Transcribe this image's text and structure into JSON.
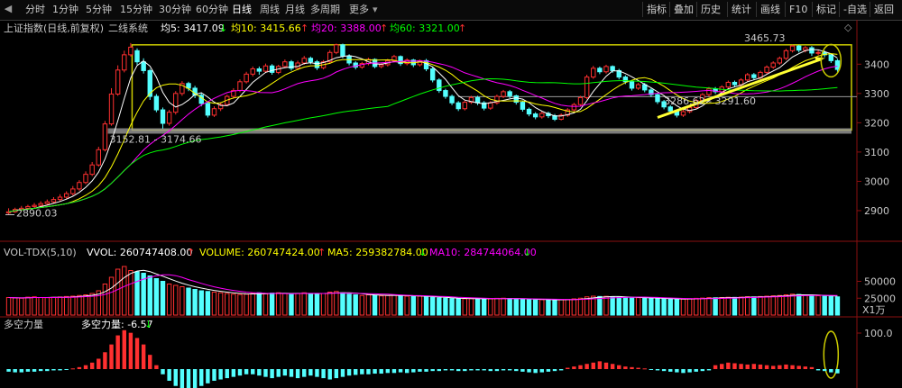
{
  "toolbar": {
    "left_tabs": [
      "分时",
      "1分钟",
      "5分钟",
      "15分钟",
      "30分钟",
      "60分钟",
      "日线",
      "周线",
      "月线",
      "多周期",
      "更多"
    ],
    "active_index": 6,
    "more_arrow": "▾",
    "right_tabs": [
      "指标",
      "叠加",
      "历史",
      "统计",
      "画线",
      "F10",
      "标记",
      "-自选",
      "返回"
    ]
  },
  "main": {
    "title": "上证指数(日线,前复权)",
    "indicator_name": "二线系统",
    "legend": [
      {
        "label": "均5: 3417.09",
        "arrow": "↓",
        "color": "#ffffff",
        "arrow_color": "#00ff00"
      },
      {
        "label": "均10: 3415.66",
        "arrow": "↑",
        "color": "#ffff00",
        "arrow_color": "#ff3030"
      },
      {
        "label": "均20: 3388.00",
        "arrow": "↑",
        "color": "#ff00ff",
        "arrow_color": "#ff3030"
      },
      {
        "label": "均60: 3321.00",
        "arrow": "↑",
        "color": "#00ff00",
        "arrow_color": "#ff3030"
      }
    ],
    "annotations": {
      "high": "3465.73",
      "zone": "3152.81 - 3174.66",
      "low": "2890.03",
      "mid": "3286.62 - 3291.60"
    }
  },
  "volume": {
    "title": "VOL-TDX(5,10)",
    "legend": [
      {
        "label": "VVOL: 260747408.00",
        "arrow": "↑",
        "color": "#ffffff",
        "arrow_color": "#ff3030"
      },
      {
        "label": "VOLUME: 260747424.00",
        "arrow": "↑",
        "color": "#ffff00",
        "arrow_color": "#ff3030"
      },
      {
        "label": "MA5: 259382784.00",
        "arrow": "↓",
        "color": "#ffff00",
        "arrow_color": "#00ff00"
      },
      {
        "label": "MA10: 284744064.00",
        "arrow": "↓",
        "color": "#ff00ff",
        "arrow_color": "#00ff00"
      }
    ],
    "unit": "X1万"
  },
  "force": {
    "title": "多空力量",
    "label": "多空力量: -6.57",
    "arrow": "↓",
    "arrow_color": "#00ff00"
  },
  "colors": {
    "up": "#ff3030",
    "down": "#54ffff",
    "ma5": "#ffffff",
    "ma10": "#ffff00",
    "ma20": "#ff00ff",
    "ma60": "#00ff00",
    "box": "#cccc00",
    "trend": "#ffff33"
  },
  "chart_data": [
    {
      "type": "candlestick",
      "y_axis": {
        "ticks": [
          2900,
          3000,
          3100,
          3200,
          3300,
          3400
        ],
        "range": [
          2820,
          3490
        ]
      },
      "candles": [
        [
          2892,
          2896,
          2886,
          2908
        ],
        [
          2896,
          2904,
          2892,
          2910
        ],
        [
          2904,
          2908,
          2898,
          2916
        ],
        [
          2908,
          2914,
          2904,
          2920
        ],
        [
          2914,
          2918,
          2906,
          2926
        ],
        [
          2918,
          2924,
          2912,
          2932
        ],
        [
          2924,
          2930,
          2918,
          2938
        ],
        [
          2930,
          2938,
          2924,
          2946
        ],
        [
          2938,
          2946,
          2932,
          2956
        ],
        [
          2946,
          2958,
          2940,
          2966
        ],
        [
          2958,
          2974,
          2952,
          2984
        ],
        [
          2974,
          2996,
          2968,
          3004
        ],
        [
          2996,
          3024,
          2990,
          3034
        ],
        [
          3024,
          3056,
          3018,
          3066
        ],
        [
          3056,
          3108,
          3050,
          3118
        ],
        [
          3108,
          3196,
          3102,
          3206
        ],
        [
          3196,
          3298,
          3190,
          3318
        ],
        [
          3298,
          3380,
          3292,
          3396
        ],
        [
          3380,
          3432,
          3372,
          3446
        ],
        [
          3432,
          3458,
          3426,
          3472
        ],
        [
          3446,
          3408,
          3398,
          3454
        ],
        [
          3408,
          3378,
          3368,
          3420
        ],
        [
          3378,
          3290,
          3278,
          3384
        ],
        [
          3290,
          3244,
          3236,
          3298
        ],
        [
          3244,
          3198,
          3180,
          3252
        ],
        [
          3198,
          3236,
          3190,
          3244
        ],
        [
          3236,
          3300,
          3228,
          3308
        ],
        [
          3300,
          3334,
          3292,
          3342
        ],
        [
          3334,
          3318,
          3308,
          3340
        ],
        [
          3318,
          3294,
          3284,
          3326
        ],
        [
          3294,
          3266,
          3256,
          3302
        ],
        [
          3266,
          3226,
          3218,
          3272
        ],
        [
          3226,
          3248,
          3220,
          3256
        ],
        [
          3248,
          3262,
          3240,
          3270
        ],
        [
          3262,
          3290,
          3256,
          3296
        ],
        [
          3290,
          3310,
          3282,
          3318
        ],
        [
          3310,
          3340,
          3304,
          3348
        ],
        [
          3340,
          3366,
          3334,
          3374
        ],
        [
          3366,
          3384,
          3358,
          3392
        ],
        [
          3384,
          3376,
          3364,
          3392
        ],
        [
          3376,
          3394,
          3370,
          3402
        ],
        [
          3394,
          3372,
          3364,
          3400
        ],
        [
          3372,
          3392,
          3366,
          3398
        ],
        [
          3392,
          3408,
          3386,
          3416
        ],
        [
          3408,
          3386,
          3378,
          3414
        ],
        [
          3386,
          3404,
          3380,
          3412
        ],
        [
          3404,
          3420,
          3398,
          3428
        ],
        [
          3420,
          3408,
          3400,
          3426
        ],
        [
          3408,
          3388,
          3380,
          3414
        ],
        [
          3388,
          3408,
          3382,
          3414
        ],
        [
          3408,
          3440,
          3402,
          3448
        ],
        [
          3440,
          3466,
          3434,
          3470
        ],
        [
          3466,
          3428,
          3420,
          3470
        ],
        [
          3428,
          3404,
          3396,
          3434
        ],
        [
          3404,
          3390,
          3382,
          3410
        ],
        [
          3390,
          3402,
          3384,
          3408
        ],
        [
          3402,
          3416,
          3396,
          3422
        ],
        [
          3416,
          3392,
          3386,
          3420
        ],
        [
          3392,
          3398,
          3386,
          3404
        ],
        [
          3398,
          3412,
          3392,
          3418
        ],
        [
          3412,
          3426,
          3406,
          3432
        ],
        [
          3426,
          3402,
          3394,
          3430
        ],
        [
          3402,
          3414,
          3396,
          3420
        ],
        [
          3414,
          3398,
          3390,
          3418
        ],
        [
          3398,
          3412,
          3392,
          3416
        ],
        [
          3412,
          3384,
          3376,
          3418
        ],
        [
          3384,
          3346,
          3338,
          3390
        ],
        [
          3346,
          3310,
          3302,
          3352
        ],
        [
          3310,
          3290,
          3282,
          3316
        ],
        [
          3290,
          3268,
          3260,
          3296
        ],
        [
          3268,
          3248,
          3240,
          3274
        ],
        [
          3248,
          3270,
          3242,
          3276
        ],
        [
          3270,
          3286,
          3264,
          3292
        ],
        [
          3286,
          3268,
          3260,
          3292
        ],
        [
          3268,
          3250,
          3242,
          3274
        ],
        [
          3250,
          3268,
          3244,
          3274
        ],
        [
          3268,
          3290,
          3262,
          3296
        ],
        [
          3290,
          3306,
          3284,
          3312
        ],
        [
          3306,
          3292,
          3284,
          3312
        ],
        [
          3292,
          3270,
          3262,
          3296
        ],
        [
          3270,
          3246,
          3238,
          3276
        ],
        [
          3246,
          3230,
          3222,
          3252
        ],
        [
          3230,
          3220,
          3212,
          3236
        ],
        [
          3220,
          3232,
          3214,
          3238
        ],
        [
          3232,
          3224,
          3216,
          3238
        ],
        [
          3224,
          3212,
          3206,
          3230
        ],
        [
          3212,
          3226,
          3208,
          3232
        ],
        [
          3226,
          3244,
          3220,
          3250
        ],
        [
          3244,
          3262,
          3238,
          3268
        ],
        [
          3262,
          3286,
          3256,
          3292
        ],
        [
          3286,
          3356,
          3280,
          3364
        ],
        [
          3356,
          3386,
          3350,
          3394
        ],
        [
          3386,
          3374,
          3366,
          3392
        ],
        [
          3374,
          3392,
          3368,
          3398
        ],
        [
          3392,
          3378,
          3370,
          3396
        ],
        [
          3378,
          3356,
          3348,
          3384
        ],
        [
          3356,
          3340,
          3332,
          3362
        ],
        [
          3340,
          3318,
          3310,
          3346
        ],
        [
          3318,
          3330,
          3312,
          3336
        ],
        [
          3330,
          3312,
          3304,
          3336
        ],
        [
          3312,
          3296,
          3288,
          3318
        ],
        [
          3296,
          3272,
          3264,
          3302
        ],
        [
          3272,
          3254,
          3246,
          3278
        ],
        [
          3254,
          3240,
          3232,
          3260
        ],
        [
          3240,
          3226,
          3218,
          3246
        ],
        [
          3226,
          3238,
          3220,
          3244
        ],
        [
          3238,
          3252,
          3232,
          3258
        ],
        [
          3252,
          3276,
          3246,
          3282
        ],
        [
          3276,
          3296,
          3270,
          3302
        ],
        [
          3296,
          3316,
          3290,
          3322
        ],
        [
          3316,
          3306,
          3298,
          3322
        ],
        [
          3306,
          3322,
          3300,
          3328
        ],
        [
          3322,
          3338,
          3316,
          3344
        ],
        [
          3338,
          3330,
          3322,
          3344
        ],
        [
          3330,
          3346,
          3324,
          3352
        ],
        [
          3346,
          3364,
          3340,
          3370
        ],
        [
          3364,
          3354,
          3346,
          3370
        ],
        [
          3354,
          3372,
          3348,
          3378
        ],
        [
          3372,
          3390,
          3366,
          3396
        ],
        [
          3390,
          3404,
          3384,
          3410
        ],
        [
          3404,
          3420,
          3398,
          3426
        ],
        [
          3420,
          3446,
          3414,
          3452
        ],
        [
          3446,
          3462,
          3440,
          3466
        ],
        [
          3462,
          3448,
          3440,
          3466
        ],
        [
          3448,
          3456,
          3440,
          3462
        ],
        [
          3456,
          3438,
          3428,
          3462
        ],
        [
          3438,
          3440,
          3430,
          3448
        ],
        [
          3440,
          3432,
          3424,
          3446
        ],
        [
          3432,
          3412,
          3404,
          3436
        ],
        [
          3412,
          3382,
          3374,
          3418
        ]
      ],
      "ma_rules": {
        "ma5": 5,
        "ma10": 10,
        "ma20": 20,
        "ma60": 60
      },
      "box": {
        "low": 3175,
        "high": 3466
      }
    },
    {
      "type": "bar",
      "name": "VOL-TDX(5,10)",
      "y_ticks": [
        25000,
        50000
      ],
      "y_range": [
        0,
        80000
      ],
      "values": [
        26000,
        25500,
        25000,
        26500,
        27000,
        26000,
        25800,
        26200,
        26800,
        27500,
        28000,
        29000,
        30000,
        32000,
        36000,
        46000,
        56000,
        68000,
        72000,
        66000,
        64000,
        62000,
        58000,
        54000,
        50000,
        46000,
        44000,
        42000,
        40000,
        38000,
        36000,
        35000,
        34000,
        33000,
        32000,
        31000,
        30500,
        31000,
        32000,
        33000,
        31500,
        32500,
        33000,
        32000,
        31000,
        32000,
        33000,
        32000,
        31000,
        32000,
        34000,
        35000,
        33000,
        31000,
        30000,
        29000,
        30000,
        29500,
        28500,
        29000,
        29500,
        28800,
        28000,
        27500,
        28000,
        27000,
        26000,
        25500,
        25000,
        24500,
        24000,
        24200,
        24500,
        24300,
        24000,
        24200,
        24800,
        25000,
        24600,
        24000,
        23500,
        23000,
        22500,
        22800,
        22600,
        22400,
        22800,
        23200,
        24000,
        25000,
        27000,
        28000,
        27500,
        27800,
        27200,
        26500,
        26000,
        25500,
        25800,
        25200,
        24800,
        24500,
        24000,
        23800,
        23500,
        23800,
        24200,
        24800,
        25200,
        25800,
        25600,
        26000,
        26400,
        26200,
        26600,
        27200,
        27000,
        27500,
        28000,
        28500,
        29000,
        30000,
        31000,
        30500,
        29800,
        29000,
        28600,
        28200,
        27600,
        27000
      ]
    },
    {
      "type": "bar",
      "name": "多空力量",
      "y_ticks": [
        100.0
      ],
      "values": [
        -4,
        -5,
        -5,
        -4,
        -4,
        -3,
        -3,
        -2,
        -2,
        -1,
        1,
        3,
        6,
        10,
        16,
        26,
        38,
        52,
        60,
        56,
        48,
        38,
        22,
        6,
        -8,
        -18,
        -26,
        -32,
        -34,
        -30,
        -26,
        -22,
        -18,
        -16,
        -14,
        -12,
        -10,
        -8,
        -8,
        -10,
        -12,
        -14,
        -12,
        -10,
        -12,
        -14,
        -12,
        -10,
        -12,
        -14,
        -16,
        -14,
        -12,
        -10,
        -9,
        -8,
        -8,
        -7,
        -7,
        -6,
        -6,
        -5,
        -6,
        -5,
        -4,
        -4,
        -3,
        -3,
        -2,
        -2,
        -3,
        -3,
        -2,
        -2,
        -2,
        -3,
        -3,
        -2,
        -2,
        -3,
        -4,
        -5,
        -6,
        -5,
        -4,
        -3,
        -2,
        2,
        4,
        6,
        8,
        10,
        12,
        10,
        8,
        6,
        4,
        3,
        2,
        1,
        -1,
        -2,
        -3,
        -4,
        -5,
        -6,
        -5,
        -4,
        -3,
        -2,
        6,
        8,
        10,
        9,
        8,
        7,
        8,
        7,
        6,
        5,
        6,
        7,
        6,
        5,
        4,
        3,
        -2,
        -3,
        -5,
        -6.57
      ]
    }
  ]
}
